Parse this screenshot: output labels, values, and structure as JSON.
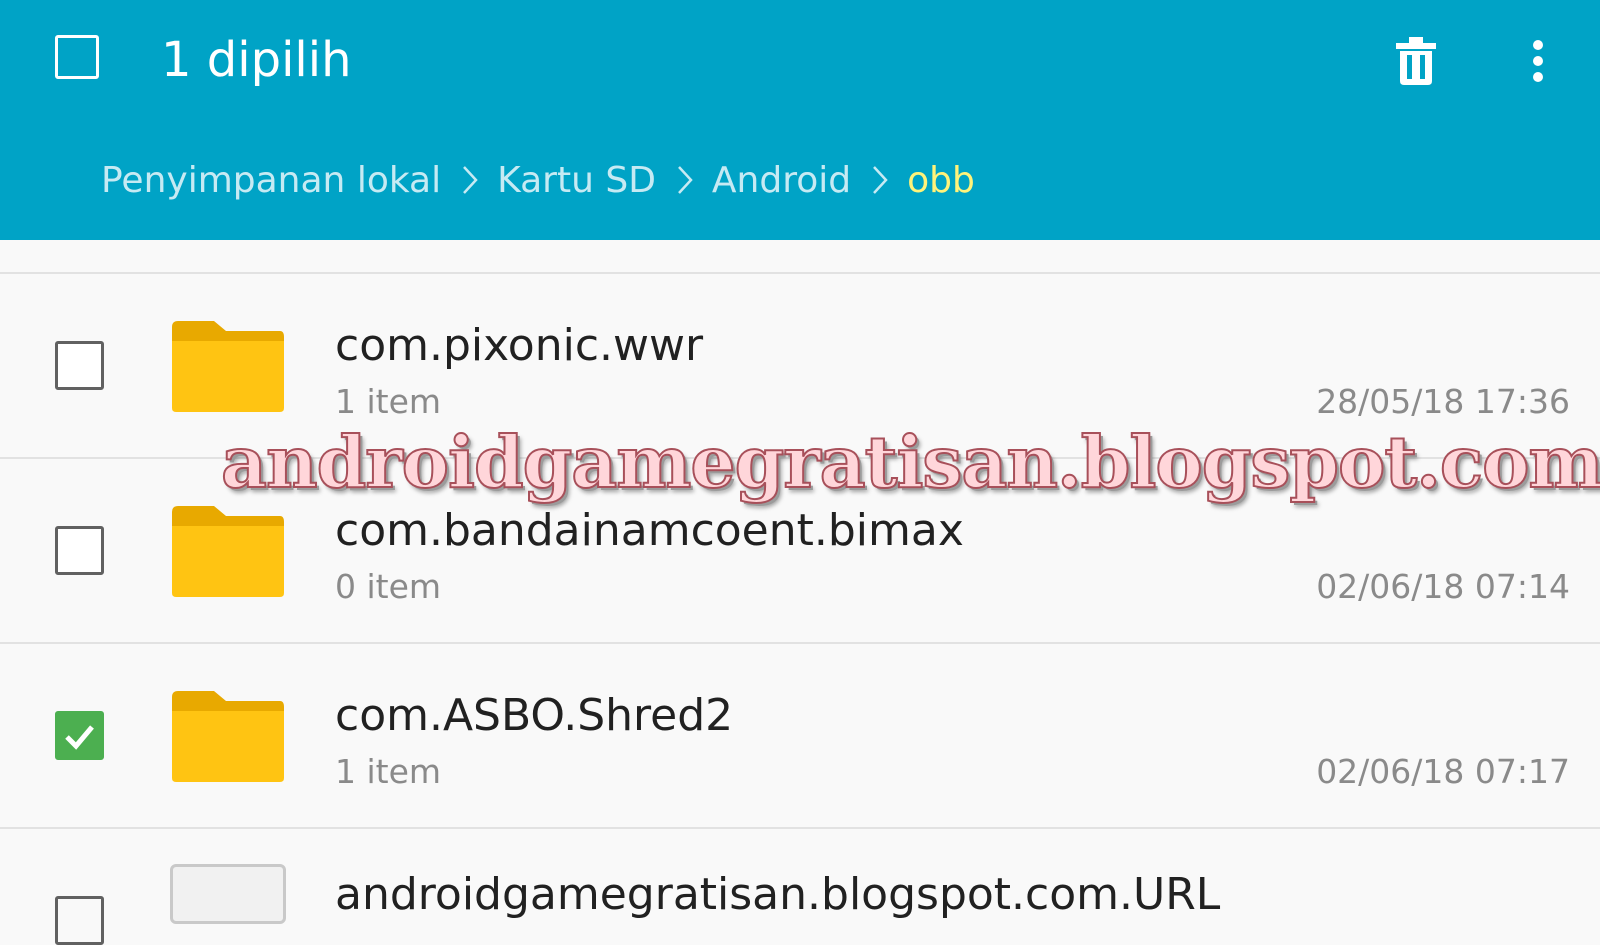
{
  "header": {
    "title": "1 dipilih",
    "select_all_checked": false,
    "background_color": "#00a3c6",
    "actions": [
      {
        "icon": "trash-icon"
      },
      {
        "icon": "more-vertical-icon"
      }
    ]
  },
  "breadcrumb": {
    "items": [
      "Penyimpanan lokal",
      "Kartu SD",
      "Android",
      "obb"
    ],
    "current_color": "#fff37a"
  },
  "files": [
    {
      "name": "com.pixonic.wwr",
      "count": "1 item",
      "date": "28/05/18 17:36",
      "checked": false,
      "icon": "folder-icon"
    },
    {
      "name": "com.bandainamcoent.bimax",
      "count": "0 item",
      "date": "02/06/18 07:14",
      "checked": false,
      "icon": "folder-icon"
    },
    {
      "name": "com.ASBO.Shred2",
      "count": "1 item",
      "date": "02/06/18 07:17",
      "checked": true,
      "icon": "folder-icon"
    },
    {
      "name": "androidgamegratisan.blogspot.com.URL",
      "icon": "file-icon",
      "checked": false
    }
  ],
  "watermark": "androidgamegratisan.blogspot.com",
  "colors": {
    "folder": "#ffc412",
    "checkbox_checked": "#4caf50"
  }
}
